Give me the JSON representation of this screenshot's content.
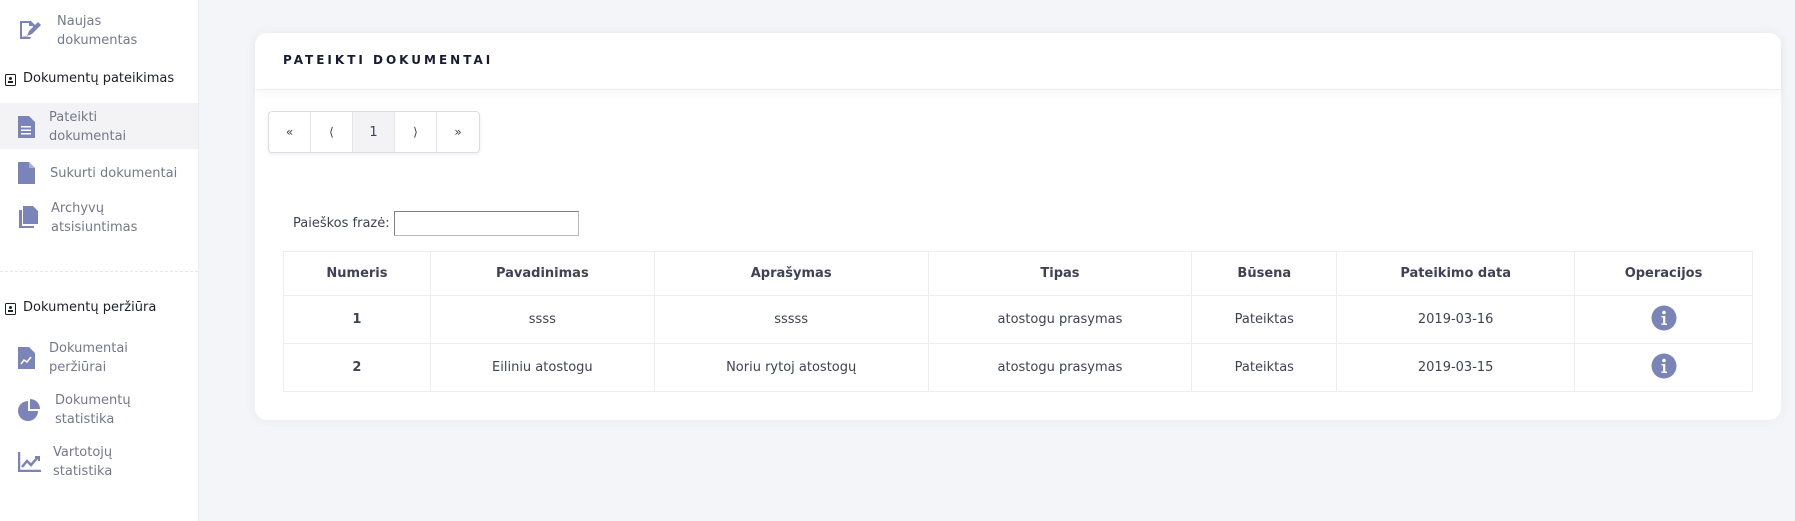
{
  "sidebar": {
    "top_item": {
      "label_line1": "Naujas",
      "label_line2": "dokumentas"
    },
    "section1": {
      "title": "Dokumentų pateikimas",
      "items": [
        {
          "label_line1": "Pateikti",
          "label_line2": "dokumentai"
        },
        {
          "label_line1": "Sukurti dokumentai",
          "label_line2": ""
        },
        {
          "label_line1": "Archyvų",
          "label_line2": "atsisiuntimas"
        }
      ]
    },
    "section2": {
      "title": "Dokumentų peržiūra",
      "items": [
        {
          "label_line1": "Dokumentai",
          "label_line2": "peržiūrai"
        },
        {
          "label_line1": "Dokumentų",
          "label_line2": "statistika"
        },
        {
          "label_line1": "Vartotojų",
          "label_line2": "statistika"
        }
      ]
    }
  },
  "card": {
    "title": "PATEIKTI DOKUMENTAI",
    "pagination": {
      "first": "«",
      "prev": "⟨",
      "current": "1",
      "next": "⟩",
      "last": "»"
    },
    "search": {
      "label": "Paieškos frazė:",
      "value": ""
    },
    "table": {
      "headers": [
        "Numeris",
        "Pavadinimas",
        "Aprašymas",
        "Tipas",
        "Būsena",
        "Pateikimo data",
        "Operacijos"
      ],
      "rows": [
        {
          "numeris": "1",
          "pavadinimas": "ssss",
          "aprasymas": "sssss",
          "tipas": "atostogu prasymas",
          "busena": "Pateiktas",
          "data": "2019-03-16",
          "operation_icon": "info-icon"
        },
        {
          "numeris": "2",
          "pavadinimas": "Eiliniu atostogu",
          "aprasymas": "Noriu rytoj atostogų",
          "tipas": "atostogu prasymas",
          "busena": "Pateiktas",
          "data": "2019-03-15",
          "operation_icon": "info-icon"
        }
      ]
    }
  },
  "colors": {
    "icon": "#7a84b8",
    "background": "#f4f5f8",
    "card": "#ffffff"
  }
}
